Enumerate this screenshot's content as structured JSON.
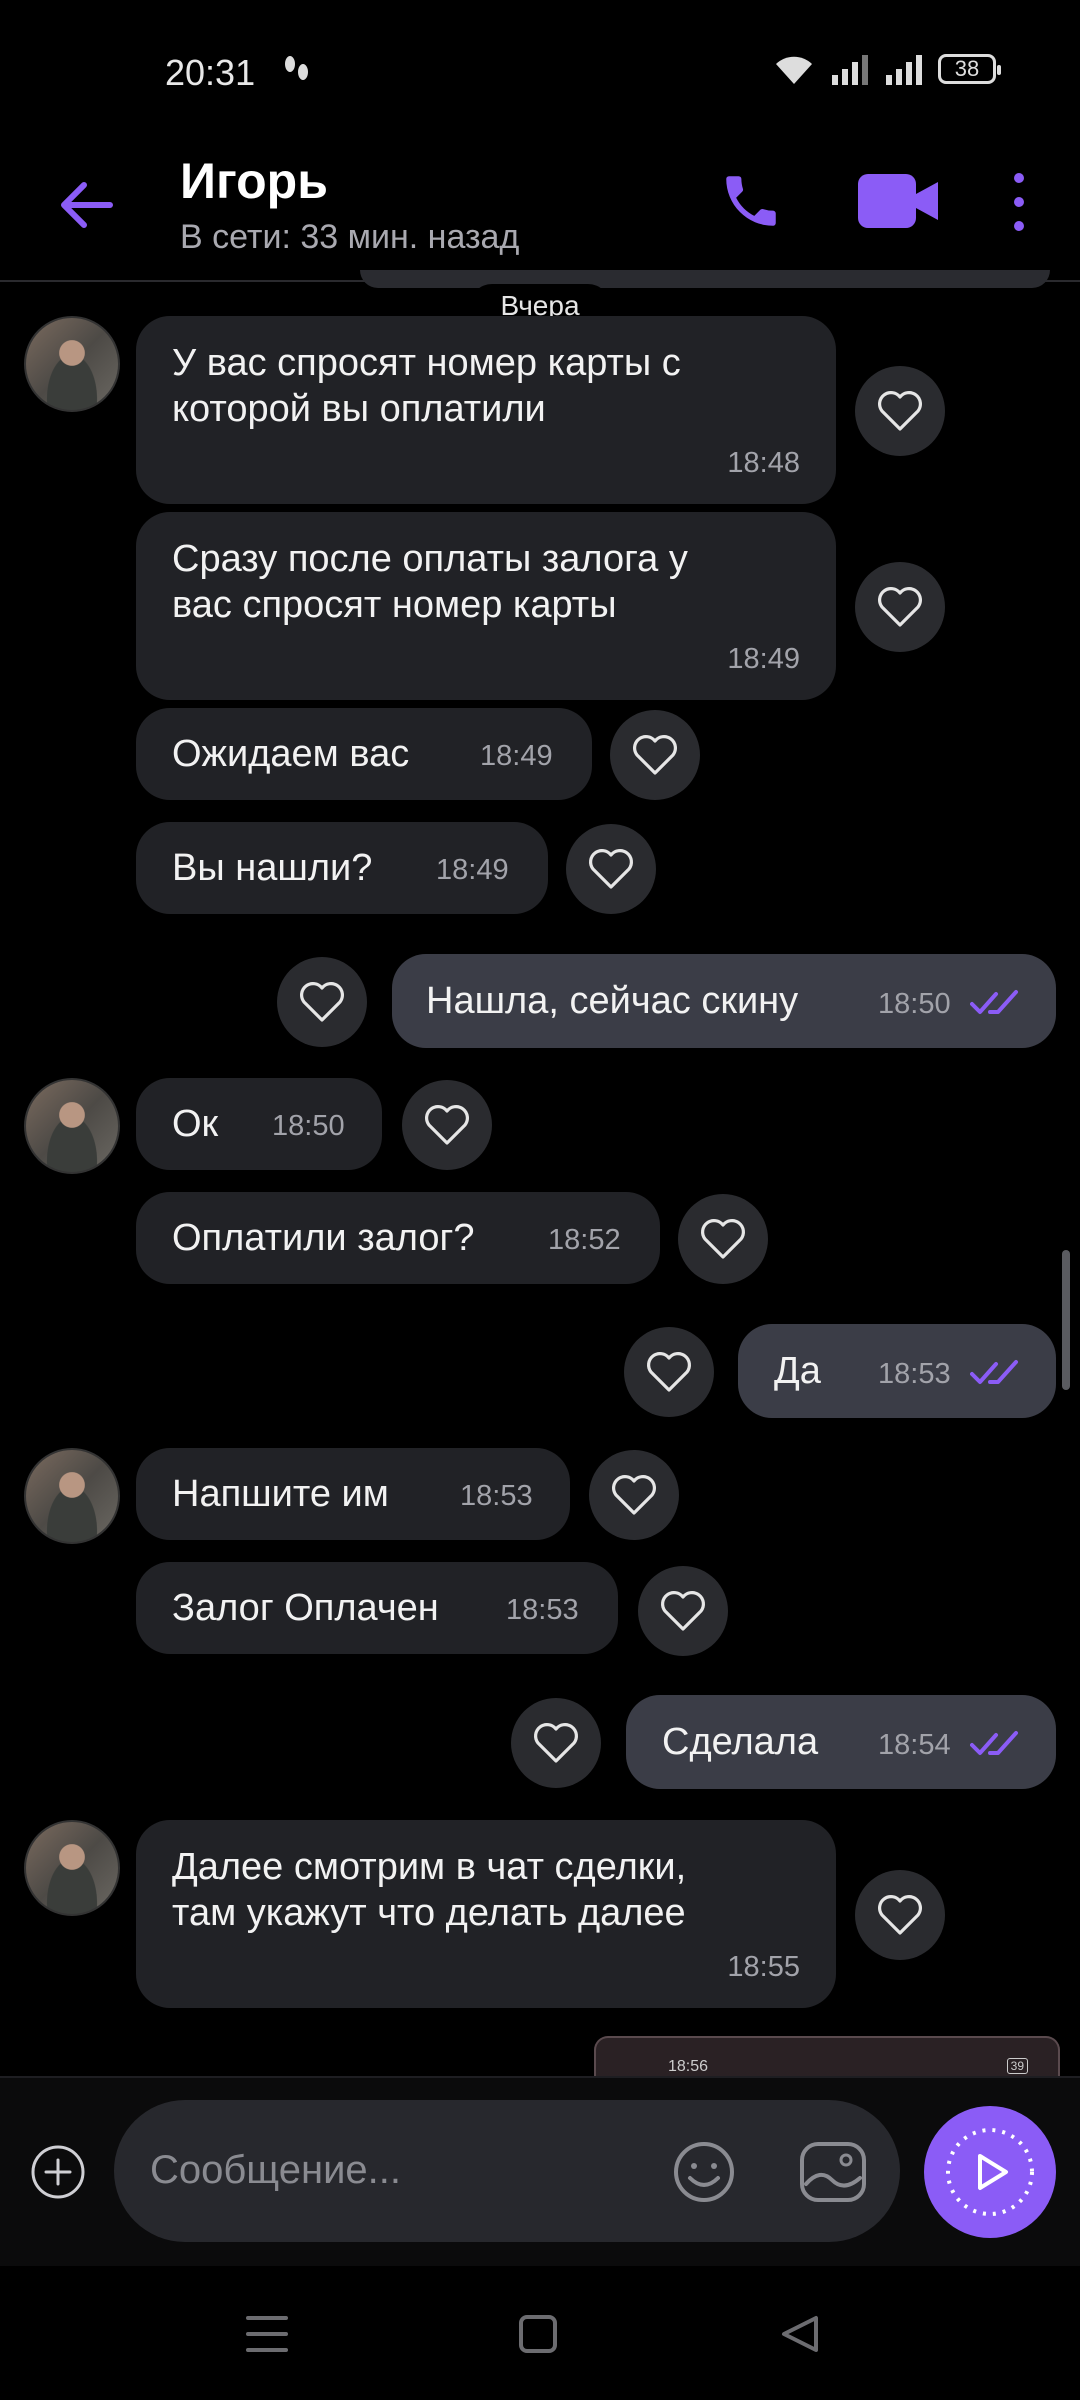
{
  "status_bar": {
    "time": "20:31",
    "battery": "38"
  },
  "header": {
    "contact_name": "Игорь",
    "presence": "В сети: 33 мин. назад"
  },
  "date_separator": "Вчера",
  "messages": [
    {
      "dir": "in",
      "text": "У вас спросят номер карты с которой вы оплатили",
      "time": "18:48"
    },
    {
      "dir": "in",
      "text": "Сразу после оплаты залога у вас спросят номер карты",
      "time": "18:49"
    },
    {
      "dir": "in",
      "text": "Ожидаем вас",
      "time": "18:49"
    },
    {
      "dir": "in",
      "text": "Вы нашли?",
      "time": "18:49"
    },
    {
      "dir": "out",
      "text": "Нашла, сейчас скину",
      "time": "18:50",
      "status": "read"
    },
    {
      "dir": "in",
      "text": "Ок",
      "time": "18:50"
    },
    {
      "dir": "in",
      "text": "Оплатили залог?",
      "time": "18:52"
    },
    {
      "dir": "out",
      "text": "Да",
      "time": "18:53",
      "status": "read"
    },
    {
      "dir": "in",
      "text": "Напшите им",
      "time": "18:53"
    },
    {
      "dir": "in",
      "text": "Залог Оплачен",
      "time": "18:53"
    },
    {
      "dir": "out",
      "text": "Сделала",
      "time": "18:54",
      "status": "read"
    },
    {
      "dir": "in",
      "text": "Далее смотрим в чат сделки, там укажут что делать далее",
      "time": "18:55"
    }
  ],
  "message_lines": {
    "m0": [
      "У вас спросят номер карты с",
      "которой вы оплатили"
    ],
    "m1": [
      "Сразу после оплаты залога у",
      "вас спросят номер карты"
    ],
    "m11": [
      "Далее смотрим в чат сделки,",
      "там укажут что делать далее"
    ]
  },
  "preview": {
    "time": "18:56",
    "battery": "39"
  },
  "composer": {
    "placeholder": "Сообщение..."
  },
  "colors": {
    "accent": "#8b5cf6",
    "incoming_bubble": "#212226",
    "outgoing_bubble": "#3b3d47",
    "background": "#000000"
  },
  "icons": [
    "back-arrow-icon",
    "phone-icon",
    "video-camera-icon",
    "more-vert-icon",
    "heart-icon",
    "double-check-icon",
    "plus-icon",
    "emoji-icon",
    "gallery-icon",
    "send-icon",
    "menu-icon",
    "home-icon",
    "back-triangle-icon"
  ]
}
